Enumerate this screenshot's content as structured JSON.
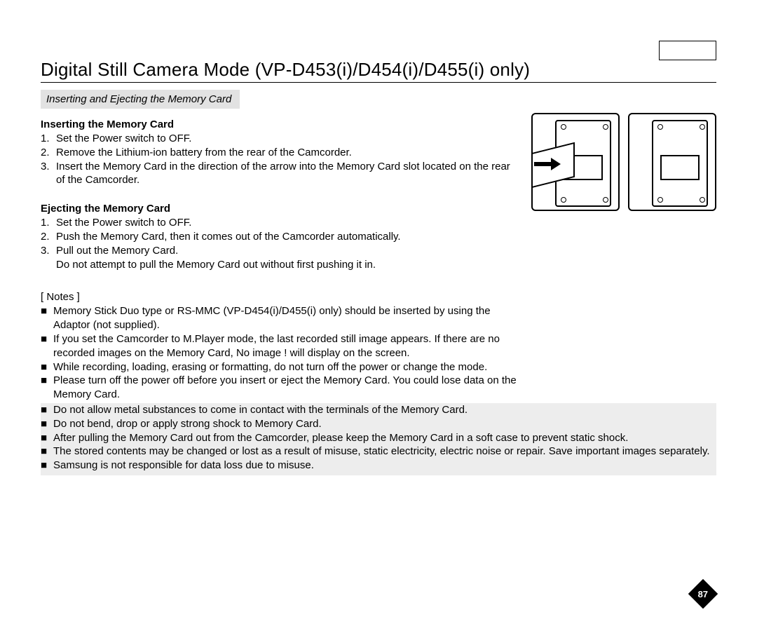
{
  "lang": "ENGLISH",
  "title": "Digital Still Camera Mode (VP-D453(i)/D454(i)/D455(i) only)",
  "section_bar": "Inserting and Ejecting the Memory Card",
  "inserting": {
    "heading": "Inserting the Memory Card",
    "steps": [
      "Set the Power switch to OFF.",
      "Remove the Lithium-ion battery from the rear of the Camcorder.",
      "Insert the Memory Card in the direction of the arrow into the Memory Card slot located on the rear of the Camcorder."
    ]
  },
  "ejecting": {
    "heading": "Ejecting the Memory Card",
    "steps": [
      "Set the Power switch to OFF.",
      "Push the Memory Card, then it comes out of the Camcorder automatically.",
      "Pull out the Memory Card.\nDo not attempt to pull the Memory Card out without first pushing it in."
    ]
  },
  "notes_label": "[ Notes ]",
  "notes_narrow": [
    "Memory Stick Duo type or RS-MMC (VP-D454(i)/D455(i) only) should be inserted by using the Adaptor (not supplied).",
    "If you set the Camcorder to M.Player mode, the last recorded still image appears. If there are no recorded images on the Memory Card, No image ! will display on the screen.",
    "While recording, loading, erasing or formatting, do not turn off the power or change the mode.",
    "Please turn off the power off before you insert or eject the Memory Card. You could lose data on the Memory Card."
  ],
  "notes_wide": [
    "Do not allow metal substances to come in contact with the terminals of the Memory Card.",
    "Do not bend, drop or apply strong shock to Memory Card.",
    "After pulling the Memory Card out from the Camcorder, please keep the Memory Card in a soft case to prevent static shock.",
    "The stored contents may be changed or lost as a result of misuse, static electricity, electric noise or repair. Save important images separately.",
    "Samsung is not responsible for data loss due to misuse."
  ],
  "page_number": "87"
}
